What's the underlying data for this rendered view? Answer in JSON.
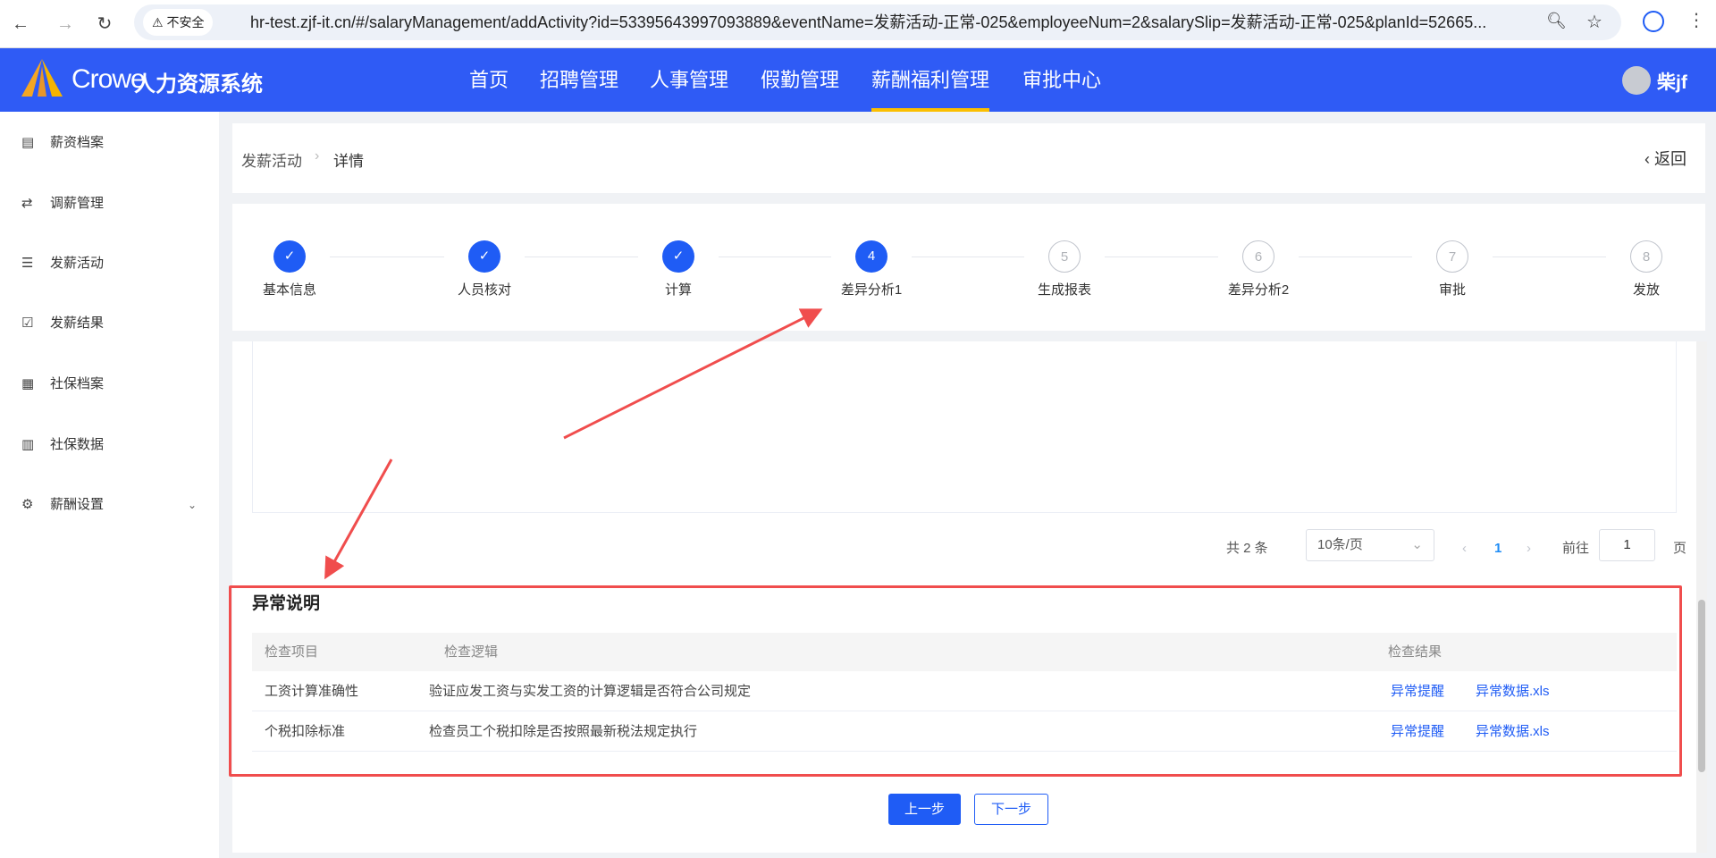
{
  "browser": {
    "security_label": "不安全",
    "url": "hr-test.zjf-it.cn/#/salaryManagement/addActivity?id=53395643997093889&eventName=发薪活动-正常-025&employeeNum=2&salarySlip=发薪活动-正常-025&planId=52665..."
  },
  "header": {
    "brand": "Crowe",
    "system_name": "人力资源系统",
    "nav": [
      "首页",
      "招聘管理",
      "人事管理",
      "假勤管理",
      "薪酬福利管理",
      "审批中心"
    ],
    "active_nav": "薪酬福利管理",
    "user": "柴jf",
    "accent": "#2f5bf5"
  },
  "sidebar": {
    "items": [
      {
        "label": "薪资档案",
        "icon": "document-icon"
      },
      {
        "label": "调薪管理",
        "icon": "exchange-icon"
      },
      {
        "label": "发薪活动",
        "icon": "list-icon"
      },
      {
        "label": "发薪结果",
        "icon": "clipboard-check-icon"
      },
      {
        "label": "社保档案",
        "icon": "grid-icon"
      },
      {
        "label": "社保数据",
        "icon": "bar-chart-icon"
      },
      {
        "label": "薪酬设置",
        "icon": "gear-icon"
      }
    ]
  },
  "breadcrumb": {
    "parent": "发薪活动",
    "current": "详情",
    "back": "返回"
  },
  "steps": [
    {
      "num": "1",
      "label": "基本信息",
      "status": "done"
    },
    {
      "num": "2",
      "label": "人员核对",
      "status": "done"
    },
    {
      "num": "3",
      "label": "计算",
      "status": "done"
    },
    {
      "num": "4",
      "label": "差异分析1",
      "status": "active"
    },
    {
      "num": "5",
      "label": "生成报表",
      "status": "todo"
    },
    {
      "num": "6",
      "label": "差异分析2",
      "status": "todo"
    },
    {
      "num": "7",
      "label": "审批",
      "status": "todo"
    },
    {
      "num": "8",
      "label": "发放",
      "status": "todo"
    }
  ],
  "pagination": {
    "total": "共 2 条",
    "page_size": "10条/页",
    "current": "1",
    "goto_label": "前往",
    "goto_value": "1",
    "page_suffix": "页"
  },
  "exceptions": {
    "title": "异常说明",
    "columns": [
      "检查项目",
      "检查逻辑",
      "检查结果"
    ],
    "rows": [
      {
        "item": "工资计算准确性",
        "logic": "验证应发工资与实发工资的计算逻辑是否符合公司规定",
        "alert": "异常提醒",
        "file": "异常数据.xls"
      },
      {
        "item": "个税扣除标准",
        "logic": "检查员工个税扣除是否按照最新税法规定执行",
        "alert": "异常提醒",
        "file": "异常数据.xls"
      }
    ]
  },
  "buttons": {
    "prev": "上一步",
    "next": "下一步"
  }
}
